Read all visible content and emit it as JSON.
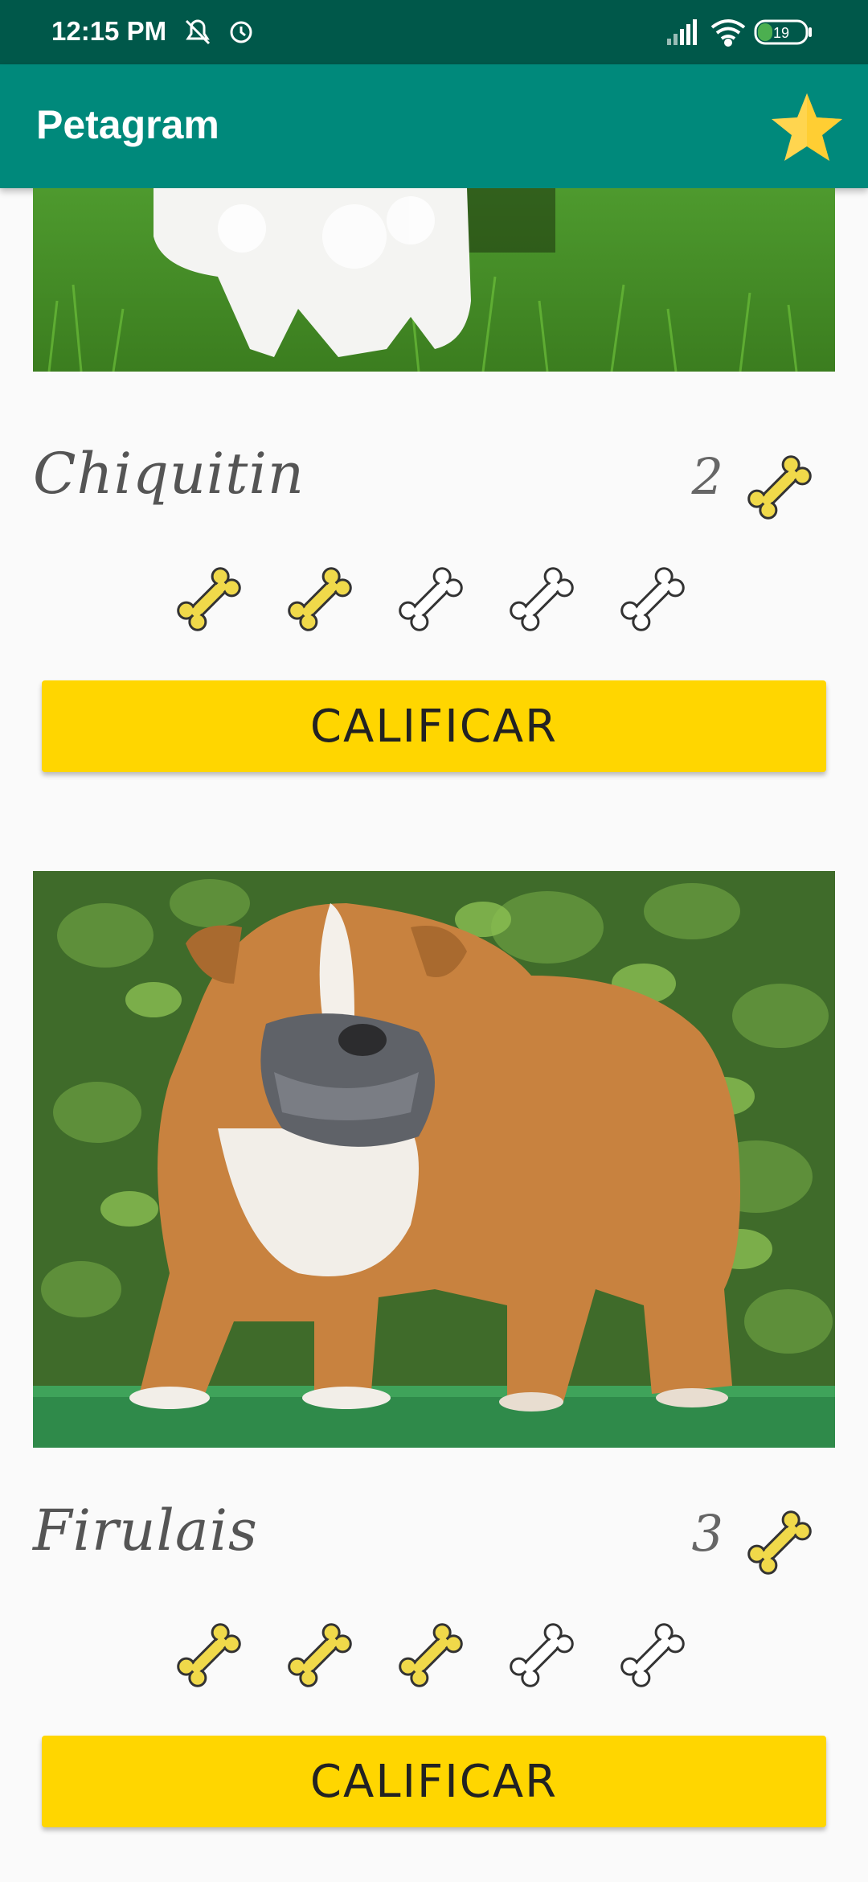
{
  "status_bar": {
    "time": "12:15 PM",
    "battery": "19",
    "icons": [
      "notifications-off-icon",
      "alarm-icon",
      "signal-icon",
      "wifi-icon",
      "battery-icon"
    ]
  },
  "app_bar": {
    "title": "Petagram",
    "action_icon": "star-icon",
    "colors": {
      "primary": "#00897b",
      "primary_dark": "#00584a",
      "accent": "#ffd600"
    }
  },
  "pets": [
    {
      "name": "Chiquitin",
      "likes": "2",
      "rating": 2,
      "max_rating": 5,
      "button_label": "CALIFICAR",
      "photo": "white-dog-on-grass"
    },
    {
      "name": "Firulais",
      "likes": "3",
      "rating": 3,
      "max_rating": 5,
      "button_label": "CALIFICAR",
      "photo": "bulldog-on-turf"
    }
  ]
}
